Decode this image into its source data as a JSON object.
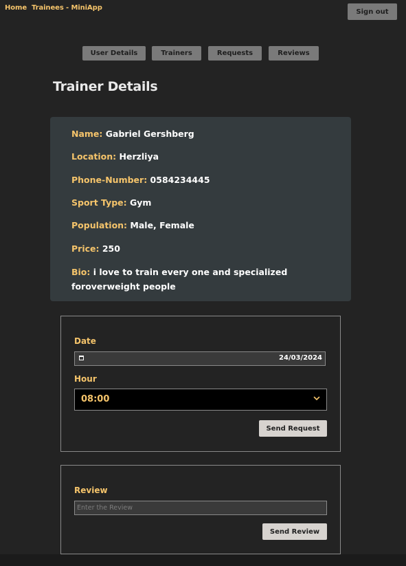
{
  "nav": {
    "home": "Home",
    "app_title": "Trainees - MiniApp",
    "sign_out": "Sign out"
  },
  "tabs": {
    "user_details": "User Details",
    "trainers": "Trainers",
    "requests": "Requests",
    "reviews": "Reviews"
  },
  "page_title": "Trainer Details",
  "trainer": {
    "name_label": "Name:",
    "name": "Gabriel Gershberg",
    "location_label": "Location:",
    "location": "Herzliya",
    "phone_label": "Phone-Number:",
    "phone": "0584234445",
    "sport_label": "Sport Type:",
    "sport": "Gym",
    "population_label": "Population:",
    "population": "Male, Female",
    "price_label": "Price:",
    "price": "250",
    "bio_label": "Bio:",
    "bio": "i love to train every one and specialized foroverweight people"
  },
  "request_form": {
    "date_label": "Date",
    "date_value": "24/03/2024",
    "hour_label": "Hour",
    "hour_value": "08:00",
    "submit": "Send Request"
  },
  "review_form": {
    "label": "Review",
    "placeholder": "Enter the Review",
    "submit": "Send Review"
  },
  "icons": {
    "date": "calendar-icon",
    "select": "chevron-down-icon"
  },
  "colors": {
    "background": "#232323",
    "accent": "#f5c46b",
    "card": "#343b3e",
    "tab_button": "#7a7a7a",
    "light_button": "#d7d3cf"
  }
}
